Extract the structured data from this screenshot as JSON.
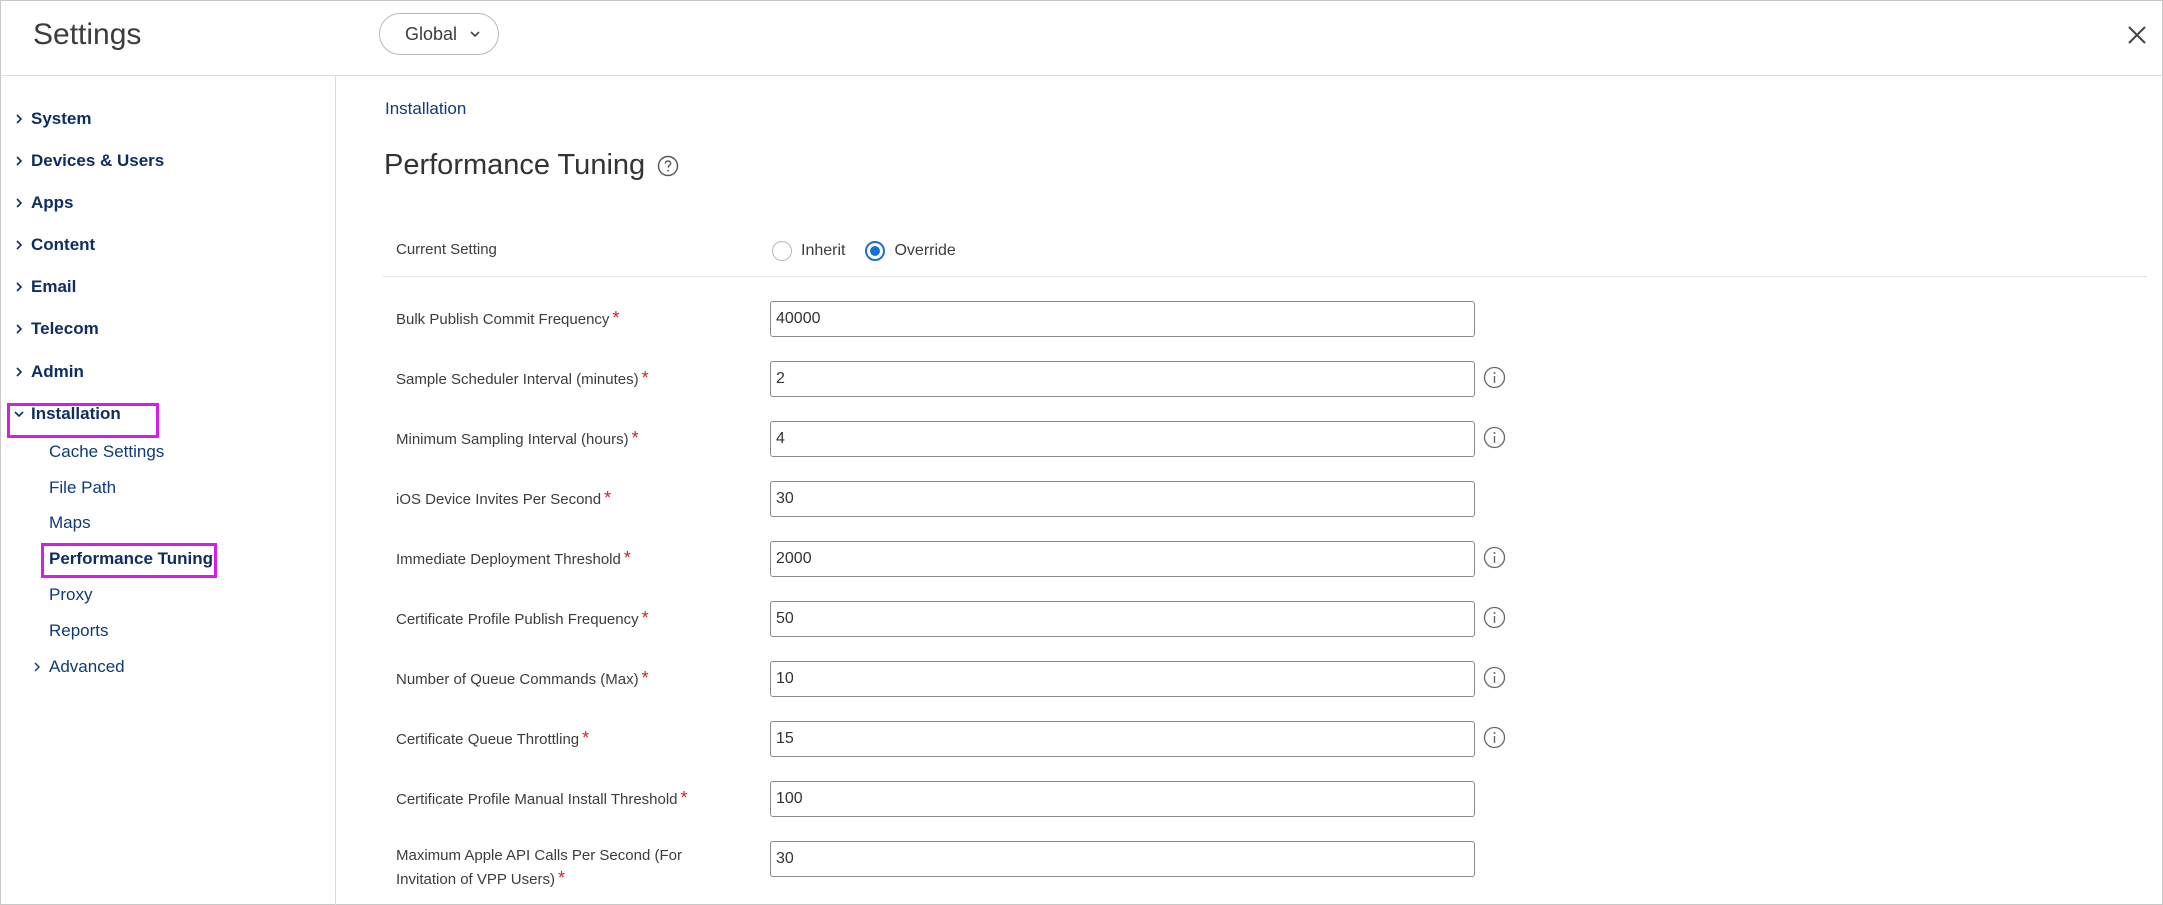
{
  "header": {
    "title": "Settings",
    "scope_select": "Global"
  },
  "sidebar": {
    "items": [
      {
        "label": "System",
        "expanded": false
      },
      {
        "label": "Devices & Users",
        "expanded": false
      },
      {
        "label": "Apps",
        "expanded": false
      },
      {
        "label": "Content",
        "expanded": false
      },
      {
        "label": "Email",
        "expanded": false
      },
      {
        "label": "Telecom",
        "expanded": false
      },
      {
        "label": "Admin",
        "expanded": false
      },
      {
        "label": "Installation",
        "expanded": true
      }
    ],
    "installation_children": [
      {
        "label": "Cache Settings"
      },
      {
        "label": "File Path"
      },
      {
        "label": "Maps"
      },
      {
        "label": "Performance Tuning",
        "active": true
      },
      {
        "label": "Proxy"
      },
      {
        "label": "Reports"
      },
      {
        "label": "Advanced"
      }
    ]
  },
  "main": {
    "breadcrumb": "Installation",
    "title": "Performance Tuning",
    "current_setting": {
      "label": "Current Setting",
      "options": [
        "Inherit",
        "Override"
      ],
      "selected": "Override"
    },
    "fields": [
      {
        "label": "Bulk Publish Commit Frequency",
        "value": "40000",
        "required": "*",
        "info": false
      },
      {
        "label": "Sample Scheduler Interval (minutes)",
        "value": "2",
        "required": "*",
        "info": true
      },
      {
        "label": "Minimum Sampling Interval (hours)",
        "value": "4",
        "required": "*",
        "info": true
      },
      {
        "label": "iOS Device Invites Per Second",
        "value": "30",
        "required": "*",
        "info": false
      },
      {
        "label": "Immediate Deployment Threshold",
        "value": "2000",
        "required": "*",
        "info": true
      },
      {
        "label": "Certificate Profile Publish Frequency",
        "value": "50",
        "required": "*",
        "info": true
      },
      {
        "label": "Number of Queue Commands (Max)",
        "value": "10",
        "required": "*",
        "info": true
      },
      {
        "label": "Certificate Queue Throttling",
        "value": "15",
        "required": "*",
        "info": true
      },
      {
        "label": "Certificate Profile Manual Install Threshold",
        "value": "100",
        "required": "*",
        "info": false
      },
      {
        "label_line1": "Maximum Apple API Calls Per Second (For",
        "label_line2": "Invitation of VPP Users)",
        "value": "30",
        "required": "*",
        "info": false
      }
    ]
  },
  "colors": {
    "nav_text": "#0e2e63",
    "highlight": "#d21ee6",
    "required": "#d42020",
    "radio_selected": "#1f6fd1"
  },
  "icons": {
    "close": "close-icon",
    "scope_chevron": "chevron-down-icon",
    "nav_caret": "chevron-right-icon",
    "help": "question-circle-icon",
    "info": "info-circle-icon"
  }
}
